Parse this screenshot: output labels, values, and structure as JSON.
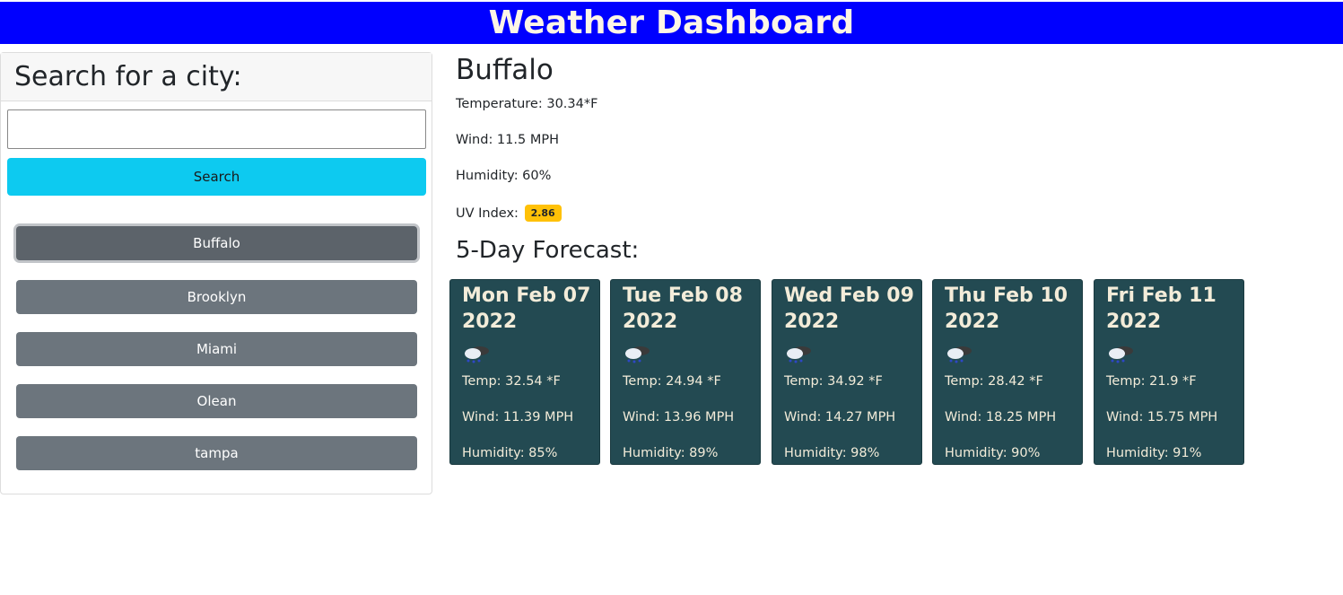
{
  "header": {
    "title": "Weather Dashboard"
  },
  "search": {
    "heading": "Search for a city:",
    "input_value": "",
    "button_label": "Search"
  },
  "history": [
    {
      "label": "Buffalo",
      "active": true
    },
    {
      "label": "Brooklyn",
      "active": false
    },
    {
      "label": "Miami",
      "active": false
    },
    {
      "label": "Olean",
      "active": false
    },
    {
      "label": "tampa",
      "active": false
    }
  ],
  "current": {
    "city": "Buffalo",
    "temperature": "Temperature: 30.34*F",
    "wind": "Wind: 11.5 MPH",
    "humidity": "Humidity: 60%",
    "uv_label": "UV Index:",
    "uv_value": "2.86",
    "uv_color": "#ffc107"
  },
  "forecast": {
    "title": "5-Day Forecast:",
    "days": [
      {
        "date": "Mon Feb 07 2022",
        "icon": "snow-cloud-icon",
        "temp": "Temp: 32.54 *F",
        "wind": "Wind: 11.39 MPH",
        "humidity": "Humidity: 85%"
      },
      {
        "date": "Tue Feb 08 2022",
        "icon": "snow-cloud-icon",
        "temp": "Temp: 24.94 *F",
        "wind": "Wind: 13.96 MPH",
        "humidity": "Humidity: 89%"
      },
      {
        "date": "Wed Feb 09 2022",
        "icon": "snow-cloud-icon",
        "temp": "Temp: 34.92 *F",
        "wind": "Wind: 14.27 MPH",
        "humidity": "Humidity: 98%"
      },
      {
        "date": "Thu Feb 10 2022",
        "icon": "snow-cloud-icon",
        "temp": "Temp: 28.42 *F",
        "wind": "Wind: 18.25 MPH",
        "humidity": "Humidity: 90%"
      },
      {
        "date": "Fri Feb 11 2022",
        "icon": "snow-cloud-icon",
        "temp": "Temp: 21.9 *F",
        "wind": "Wind: 15.75 MPH",
        "humidity": "Humidity: 91%"
      }
    ]
  },
  "colors": {
    "header_bg": "#0000ff",
    "search_button": "#0dcaf0",
    "history_button": "#6c757d",
    "card_bg": "#234a52"
  }
}
